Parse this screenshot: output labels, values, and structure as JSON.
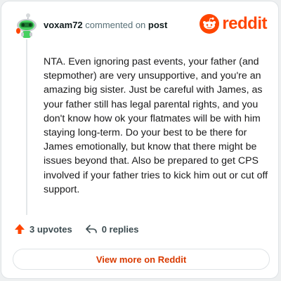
{
  "header": {
    "username": "voxam72",
    "action": "commented on",
    "post_link": "post",
    "brand": "reddit"
  },
  "comment": {
    "text": "NTA. Even ignoring past events, your father (and stepmother) are very unsupportive, and you're an amazing big sister. Just be careful with James, as your father still has legal parental rights, and you don't know how ok your flatmates will be with him staying long-term. Do your best to be there for James emotionally, but know that there might be issues beyond that. Also be prepared to get CPS involved if your father tries to kick him out or cut off support."
  },
  "actions": {
    "upvotes": "3 upvotes",
    "replies": "0 replies"
  },
  "cta": {
    "label": "View more on Reddit"
  },
  "colors": {
    "brand": "#ff4500",
    "link": "#d93a00",
    "avatar_green": "#46d160"
  }
}
